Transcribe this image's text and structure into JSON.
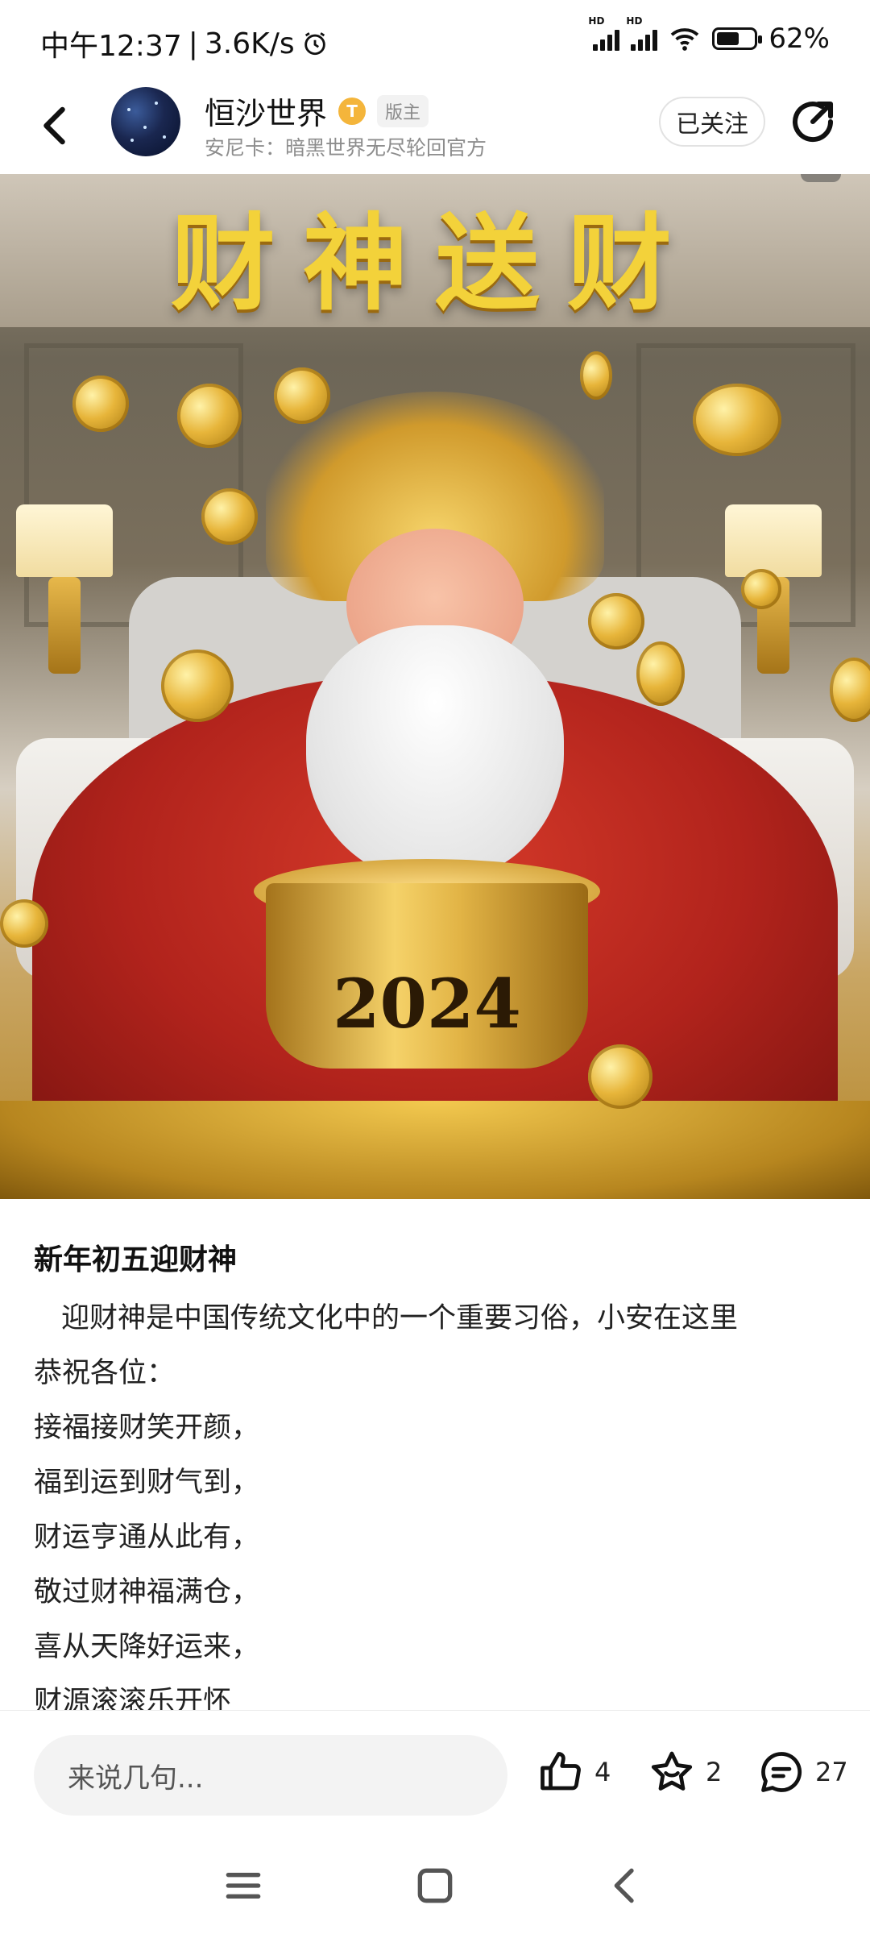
{
  "status_bar": {
    "time": "中午12:37",
    "network_speed": "3.6K/s",
    "signal_tag": "HD",
    "battery_percent": "62%",
    "battery_level": 0.62
  },
  "header": {
    "user_name": "恒沙世界",
    "level_badge": "T",
    "role_badge": "版主",
    "subtitle": "安尼卡：暗黑世界无尽轮回官方",
    "follow_label": "已关注"
  },
  "hero": {
    "title_art": "财神送财",
    "pot_label": "2024"
  },
  "post": {
    "title": "新年初五迎财神",
    "lines": [
      "迎财神是中国传统文化中的一个重要习俗，小安在这里",
      "恭祝各位：",
      "接福接财笑开颜，",
      "福到运到财气到，",
      "财运亨通从此有，",
      "敬过财神福满仓，",
      "喜从天降好运来，",
      "财源滚滚乐开怀"
    ]
  },
  "actions": {
    "comment_placeholder": "来说几句...",
    "like_count": "4",
    "favorite_count": "2",
    "comment_count": "27"
  },
  "icons": {
    "back": "back-arrow-icon",
    "share": "share-icon",
    "like": "thumbs-up-icon",
    "favorite": "star-icon",
    "comment": "comment-icon",
    "alarm": "alarm-icon",
    "wifi": "wifi-icon",
    "battery": "battery-icon",
    "nav_menu": "menu-icon",
    "nav_home": "home-icon",
    "nav_back": "nav-back-icon"
  },
  "colors": {
    "accent_gold": "#f4b53b",
    "text_primary": "#111111",
    "text_secondary": "#8d8d8d"
  }
}
